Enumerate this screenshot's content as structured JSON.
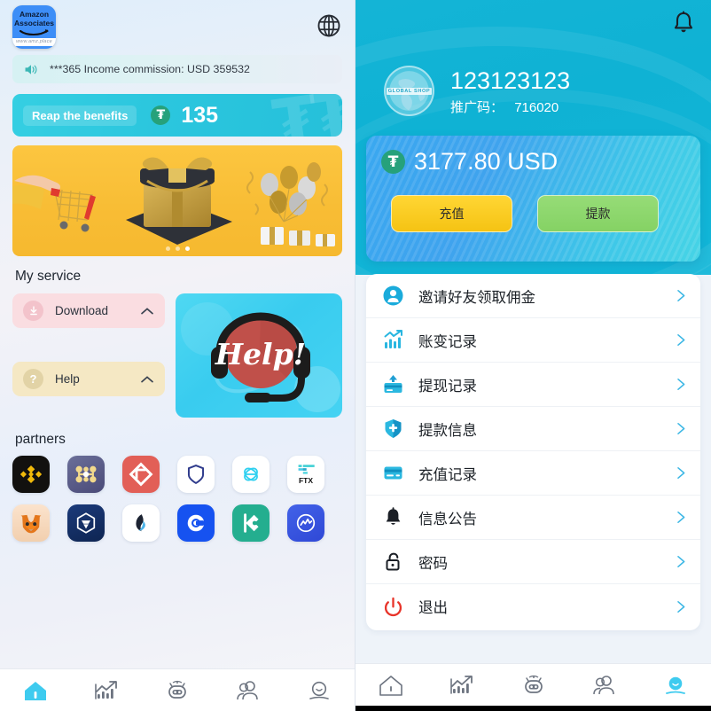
{
  "left": {
    "brand": {
      "line1": "Amazon",
      "line2": "Associates",
      "url": "www.amz.place",
      "icon": "amazon-associates-logo"
    },
    "language_icon": "globe-icon",
    "notice": {
      "icon": "speaker-icon",
      "text": "***365 Income commission:  USD 359532"
    },
    "reap": {
      "pill_label": "Reap the benefits",
      "coin_icon": "tether-usdt-icon",
      "coin_symbol": "₮",
      "value": "135"
    },
    "banner": {
      "alt": "promo-gift-banner",
      "dots": 3,
      "active_dot": 3
    },
    "service": {
      "title": "My service",
      "buttons": [
        {
          "label": "Download",
          "icon": "download-circle-icon",
          "chevron": "chevron-up-icon"
        },
        {
          "label": "Help",
          "icon": "question-circle-icon",
          "chevron": "chevron-up-icon"
        }
      ],
      "help_card": {
        "label": "Help!",
        "icon": "headset-support-icon"
      }
    },
    "partners": {
      "title": "partners",
      "items": [
        {
          "name": "binance-icon",
          "label": "Binance"
        },
        {
          "name": "ethereum-nodes-icon",
          "label": "Nodes"
        },
        {
          "name": "gate-io-icon",
          "label": "Gate.io"
        },
        {
          "name": "shield-wallet-icon",
          "label": "SafePal"
        },
        {
          "name": "sushiswap-icon",
          "label": "SushiSwap"
        },
        {
          "name": "ftx-icon",
          "label": "FTX"
        },
        {
          "name": "metamask-icon",
          "label": "MetaMask"
        },
        {
          "name": "crypto-com-icon",
          "label": "Crypto.com"
        },
        {
          "name": "huobi-icon",
          "label": "Huobi"
        },
        {
          "name": "coinbase-icon",
          "label": "Coinbase"
        },
        {
          "name": "kucoin-icon",
          "label": "KuCoin"
        },
        {
          "name": "coinmarketcap-icon",
          "label": "CoinMarketCap"
        }
      ]
    },
    "tabbar": {
      "active_index": 0,
      "items": [
        {
          "icon": "home-icon",
          "label": "Home"
        },
        {
          "icon": "chart-growth-icon",
          "label": "Market"
        },
        {
          "icon": "robot-icon",
          "label": "Robot"
        },
        {
          "icon": "team-icon",
          "label": "Team"
        },
        {
          "icon": "profile-icon",
          "label": "Me"
        }
      ]
    }
  },
  "right": {
    "notification_icon": "bell-icon",
    "profile": {
      "avatar_icon": "global-shop-globe-icon",
      "avatar_text": "GLOBAL SHOP",
      "username": "123123123",
      "promo_label": "推广码：",
      "promo_code": "716020"
    },
    "balance": {
      "coin_icon": "tether-usdt-icon",
      "coin_symbol": "₮",
      "amount": "3177.80 USD",
      "recharge_label": "充值",
      "withdraw_label": "提款"
    },
    "menu": [
      {
        "label": "邀请好友领取佣金",
        "icon": "user-circle-icon",
        "chevron": "chevron-right-icon"
      },
      {
        "label": "账变记录",
        "icon": "chart-bars-icon",
        "chevron": "chevron-right-icon"
      },
      {
        "label": "提现记录",
        "icon": "card-upload-icon",
        "chevron": "chevron-right-icon"
      },
      {
        "label": "提款信息",
        "icon": "shield-plus-icon",
        "chevron": "chevron-right-icon"
      },
      {
        "label": "充值记录",
        "icon": "credit-card-icon",
        "chevron": "chevron-right-icon"
      },
      {
        "label": "信息公告",
        "icon": "bell-icon",
        "chevron": "chevron-right-icon"
      },
      {
        "label": "密码",
        "icon": "lock-icon",
        "chevron": "chevron-right-icon"
      },
      {
        "label": "退出",
        "icon": "power-icon",
        "chevron": "chevron-right-icon"
      }
    ],
    "tabbar": {
      "active_index": 4,
      "items": [
        {
          "icon": "home-icon",
          "label": "Home"
        },
        {
          "icon": "chart-growth-icon",
          "label": "Market"
        },
        {
          "icon": "robot-icon",
          "label": "Robot"
        },
        {
          "icon": "team-icon",
          "label": "Team"
        },
        {
          "icon": "profile-icon",
          "label": "Me"
        }
      ]
    }
  },
  "colors": {
    "accent_cyan": "#2bc6de",
    "hero_cyan": "#12b6d8",
    "tether_green": "#26a17b",
    "recharge_yellow": "#f5c313",
    "withdraw_green": "#85d264",
    "banner_yellow": "#f8bd35",
    "logout_red": "#e8342a"
  }
}
